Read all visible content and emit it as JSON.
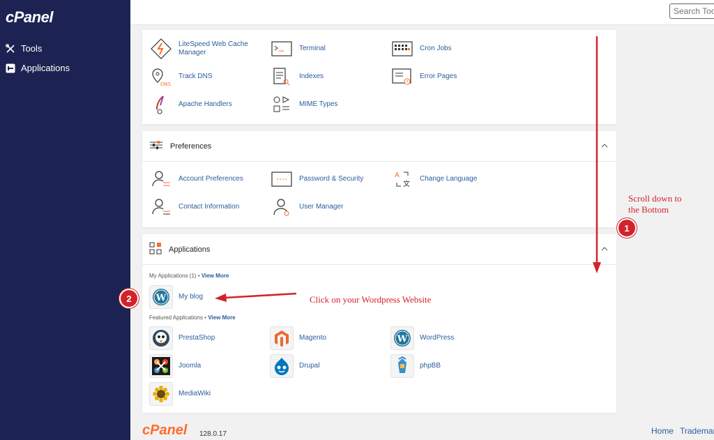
{
  "brand": {
    "logo": "cPanel",
    "version": "128.0.17"
  },
  "sidebar": {
    "items": [
      {
        "label": "Tools"
      },
      {
        "label": "Applications"
      }
    ]
  },
  "search": {
    "placeholder": "Search Tools"
  },
  "advanced": {
    "items": [
      {
        "label": "LiteSpeed Web Cache Manager"
      },
      {
        "label": "Terminal"
      },
      {
        "label": "Cron Jobs"
      },
      {
        "label": "Track DNS"
      },
      {
        "label": "Indexes"
      },
      {
        "label": "Error Pages"
      },
      {
        "label": "Apache Handlers"
      },
      {
        "label": "MIME Types"
      }
    ]
  },
  "preferences": {
    "title": "Preferences",
    "items": [
      {
        "label": "Account Preferences"
      },
      {
        "label": "Password & Security"
      },
      {
        "label": "Change Language"
      },
      {
        "label": "Contact Information"
      },
      {
        "label": "User Manager"
      }
    ]
  },
  "applications": {
    "title": "Applications",
    "my_apps_label": "My Applications (1) •",
    "view_more": "View More",
    "my_apps": [
      {
        "label": "My blog"
      }
    ],
    "featured_label": "Featured Applications •",
    "featured": [
      {
        "label": "PrestaShop"
      },
      {
        "label": "Magento"
      },
      {
        "label": "WordPress"
      },
      {
        "label": "Joomla"
      },
      {
        "label": "Drupal"
      },
      {
        "label": "phpBB"
      },
      {
        "label": "MediaWiki"
      }
    ]
  },
  "annotations": {
    "step1_number": "1",
    "step1_text_line1": "Scroll down to",
    "step1_text_line2": "the Bottom",
    "step2_number": "2",
    "step2_text": "Click on your Wordpress Website"
  },
  "footer": {
    "links": [
      {
        "label": "Home"
      },
      {
        "label": "Trademarks"
      }
    ]
  },
  "colors": {
    "sidebar": "#1c2352",
    "link": "#2b5c9c",
    "annotation": "#d3232a",
    "brand_orange": "#ff6c2c"
  }
}
